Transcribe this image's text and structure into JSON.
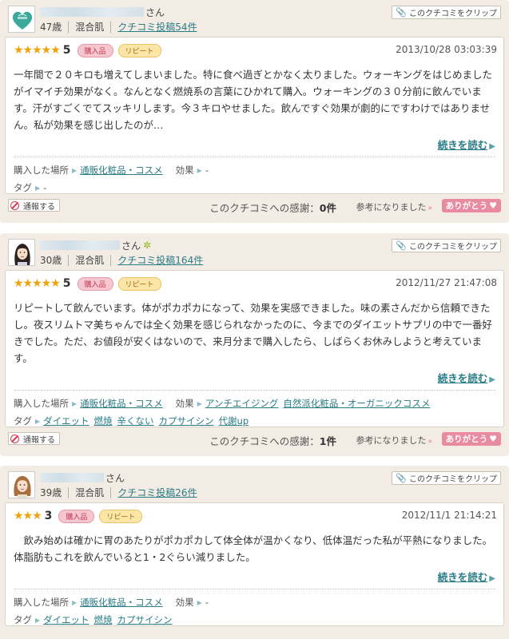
{
  "ui": {
    "clip_label": "このクチコミをクリップ",
    "san": "さん",
    "buy_badge": "購入品",
    "repeat_badge": "リピート",
    "read_more": "続きを読む",
    "place_label": "購入した場所",
    "effect_label": "効果",
    "tag_label": "タグ",
    "report_label": "通報する",
    "thanks_prefix": "このクチコミへの感謝：",
    "helpful_label": "参考になりました",
    "arigato_label": "ありがとう",
    "colors": {
      "accent": "#2a7c86",
      "star": "#f0a20a",
      "panel": "#f2ece4",
      "pink": "#e88aa0"
    }
  },
  "reviews": [
    {
      "age": "47歳",
      "skin": "混合肌",
      "posts_link": "クチコミ投稿54件",
      "stars": "★★★★★",
      "score": "5",
      "date": "2013/10/28 03:03:39",
      "body": "一年間で２０キロも増えてしまいました。特に食べ過ぎとかなく太りました。ウォーキングをはじめましたがイマイチ効果がなく。なんとなく燃焼系の言葉にひかれて購入。ウォーキングの３０分前に飲んでいます。汗がすごくでてスッキリします。今３キロやせました。飲んですぐ効果が劇的にですわけではありません。私が効果を感じ出したのが…",
      "place": "通販化粧品・コスメ",
      "effects": [
        "-"
      ],
      "tags": [
        "-"
      ],
      "thanks_count": "0件",
      "avatar": "heart-leaf-icon"
    },
    {
      "age": "30歳",
      "skin": "混合肌",
      "posts_link": "クチコミ投稿164件",
      "stars": "★★★★★",
      "score": "5",
      "date": "2012/11/27 21:47:08",
      "body": "リピートして飲んでいます。体がポカポカになって、効果を実感できました。味の素さんだから信頼できたし。夜スリムトマ美ちゃんでは全く効果を感じられなかったのに、今までのダイエットサプリの中で一番好きでした。ただ、お値段が安くはないので、来月分まで購入したら、しばらくお休みしようと考えています。",
      "place": "通販化粧品・コスメ",
      "effects": [
        "アンチエイジング",
        "自然派化粧品・オーガニックコスメ"
      ],
      "tags": [
        "ダイエット",
        "燃焼",
        "辛くない",
        "カプサイシン",
        "代謝up"
      ],
      "thanks_count": "1件",
      "avatar": "woman-dark-hair-icon"
    },
    {
      "age": "39歳",
      "skin": "混合肌",
      "posts_link": "クチコミ投稿26件",
      "stars": "★★★",
      "score": "3",
      "date": "2012/11/1 21:14:21",
      "body": "　飲み始めは確かに胃のあたりがポカポカして体全体が温かくなり、低体温だった私が平熱になりました。体脂肪もこれを飲んでいると1・2ぐらい減りました。",
      "place": "通販化粧品・コスメ",
      "effects": [
        "-"
      ],
      "tags": [
        "ダイエット",
        "燃焼",
        "カプサイシン"
      ],
      "avatar": "woman-brown-hair-icon"
    }
  ]
}
